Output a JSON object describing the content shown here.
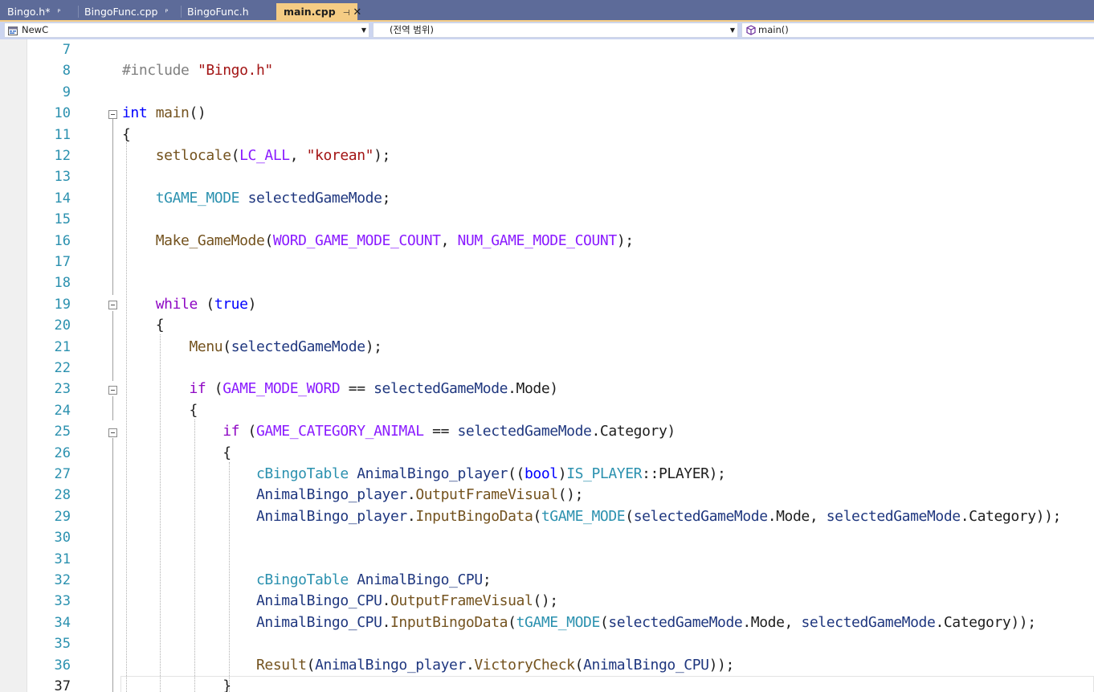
{
  "tabs": [
    {
      "label": "Bingo.h*",
      "pin": "ᴾ"
    },
    {
      "label": "BingoFunc.cpp",
      "pin": "ᴾ"
    },
    {
      "label": "BingoFunc.h"
    },
    {
      "label": "main.cpp",
      "pin": "⊣",
      "close": "✕"
    }
  ],
  "navigation": {
    "project": "NewC",
    "scope": "(전역 범위)",
    "member": "main()"
  },
  "editor": {
    "current_line": 37,
    "lines": [
      {
        "num": "7",
        "tokens": []
      },
      {
        "num": "8",
        "tokens": [
          [
            "preproc",
            "#include "
          ],
          [
            "str",
            "\"Bingo.h\""
          ]
        ]
      },
      {
        "num": "9",
        "tokens": []
      },
      {
        "num": "10",
        "tokens": [
          [
            "kw",
            "int"
          ],
          [
            "plain",
            " "
          ],
          [
            "func",
            "main"
          ],
          [
            "plain",
            "()"
          ]
        ]
      },
      {
        "num": "11",
        "tokens": [
          [
            "plain",
            "{"
          ]
        ]
      },
      {
        "num": "12",
        "tokens": [
          [
            "plain",
            "    "
          ],
          [
            "func",
            "setlocale"
          ],
          [
            "plain",
            "("
          ],
          [
            "macro",
            "LC_ALL"
          ],
          [
            "plain",
            ", "
          ],
          [
            "str",
            "\"korean\""
          ],
          [
            "plain",
            ");"
          ]
        ]
      },
      {
        "num": "13",
        "tokens": []
      },
      {
        "num": "14",
        "tokens": [
          [
            "plain",
            "    "
          ],
          [
            "type",
            "tGAME_MODE"
          ],
          [
            "plain",
            " "
          ],
          [
            "var",
            "selectedGameMode"
          ],
          [
            "plain",
            ";"
          ]
        ]
      },
      {
        "num": "15",
        "tokens": []
      },
      {
        "num": "16",
        "tokens": [
          [
            "plain",
            "    "
          ],
          [
            "func",
            "Make_GameMode"
          ],
          [
            "plain",
            "("
          ],
          [
            "macro",
            "WORD_GAME_MODE_COUNT"
          ],
          [
            "plain",
            ", "
          ],
          [
            "macro",
            "NUM_GAME_MODE_COUNT"
          ],
          [
            "plain",
            ");"
          ]
        ]
      },
      {
        "num": "17",
        "tokens": []
      },
      {
        "num": "18",
        "tokens": []
      },
      {
        "num": "19",
        "tokens": [
          [
            "plain",
            "    "
          ],
          [
            "ctrl",
            "while"
          ],
          [
            "plain",
            " ("
          ],
          [
            "kw",
            "true"
          ],
          [
            "plain",
            ")"
          ]
        ]
      },
      {
        "num": "20",
        "tokens": [
          [
            "plain",
            "    {"
          ]
        ]
      },
      {
        "num": "21",
        "tokens": [
          [
            "plain",
            "        "
          ],
          [
            "func",
            "Menu"
          ],
          [
            "plain",
            "("
          ],
          [
            "var",
            "selectedGameMode"
          ],
          [
            "plain",
            ");"
          ]
        ]
      },
      {
        "num": "22",
        "tokens": []
      },
      {
        "num": "23",
        "tokens": [
          [
            "plain",
            "        "
          ],
          [
            "ctrl",
            "if"
          ],
          [
            "plain",
            " ("
          ],
          [
            "macro",
            "GAME_MODE_WORD"
          ],
          [
            "plain",
            " == "
          ],
          [
            "var",
            "selectedGameMode"
          ],
          [
            "plain",
            ".Mode)"
          ]
        ]
      },
      {
        "num": "24",
        "tokens": [
          [
            "plain",
            "        {"
          ]
        ]
      },
      {
        "num": "25",
        "tokens": [
          [
            "plain",
            "            "
          ],
          [
            "ctrl",
            "if"
          ],
          [
            "plain",
            " ("
          ],
          [
            "macro",
            "GAME_CATEGORY_ANIMAL"
          ],
          [
            "plain",
            " == "
          ],
          [
            "var",
            "selectedGameMode"
          ],
          [
            "plain",
            ".Category)"
          ]
        ]
      },
      {
        "num": "26",
        "tokens": [
          [
            "plain",
            "            {"
          ]
        ]
      },
      {
        "num": "27",
        "tokens": [
          [
            "plain",
            "                "
          ],
          [
            "type",
            "cBingoTable"
          ],
          [
            "plain",
            " "
          ],
          [
            "var",
            "AnimalBingo_player"
          ],
          [
            "plain",
            "(("
          ],
          [
            "kw",
            "bool"
          ],
          [
            "plain",
            ")"
          ],
          [
            "type",
            "IS_PLAYER"
          ],
          [
            "plain",
            "::PLAYER);"
          ]
        ]
      },
      {
        "num": "28",
        "tokens": [
          [
            "plain",
            "                "
          ],
          [
            "var",
            "AnimalBingo_player"
          ],
          [
            "plain",
            "."
          ],
          [
            "func",
            "OutputFrameVisual"
          ],
          [
            "plain",
            "();"
          ]
        ]
      },
      {
        "num": "29",
        "tokens": [
          [
            "plain",
            "                "
          ],
          [
            "var",
            "AnimalBingo_player"
          ],
          [
            "plain",
            "."
          ],
          [
            "func",
            "InputBingoData"
          ],
          [
            "plain",
            "("
          ],
          [
            "type",
            "tGAME_MODE"
          ],
          [
            "plain",
            "("
          ],
          [
            "var",
            "selectedGameMode"
          ],
          [
            "plain",
            ".Mode, "
          ],
          [
            "var",
            "selectedGameMode"
          ],
          [
            "plain",
            ".Category));"
          ]
        ]
      },
      {
        "num": "30",
        "tokens": []
      },
      {
        "num": "31",
        "tokens": []
      },
      {
        "num": "32",
        "tokens": [
          [
            "plain",
            "                "
          ],
          [
            "type",
            "cBingoTable"
          ],
          [
            "plain",
            " "
          ],
          [
            "var",
            "AnimalBingo_CPU"
          ],
          [
            "plain",
            ";"
          ]
        ]
      },
      {
        "num": "33",
        "tokens": [
          [
            "plain",
            "                "
          ],
          [
            "var",
            "AnimalBingo_CPU"
          ],
          [
            "plain",
            "."
          ],
          [
            "func",
            "OutputFrameVisual"
          ],
          [
            "plain",
            "();"
          ]
        ]
      },
      {
        "num": "34",
        "tokens": [
          [
            "plain",
            "                "
          ],
          [
            "var",
            "AnimalBingo_CPU"
          ],
          [
            "plain",
            "."
          ],
          [
            "func",
            "InputBingoData"
          ],
          [
            "plain",
            "("
          ],
          [
            "type",
            "tGAME_MODE"
          ],
          [
            "plain",
            "("
          ],
          [
            "var",
            "selectedGameMode"
          ],
          [
            "plain",
            ".Mode, "
          ],
          [
            "var",
            "selectedGameMode"
          ],
          [
            "plain",
            ".Category));"
          ]
        ]
      },
      {
        "num": "35",
        "tokens": []
      },
      {
        "num": "36",
        "tokens": [
          [
            "plain",
            "                "
          ],
          [
            "func",
            "Result"
          ],
          [
            "plain",
            "("
          ],
          [
            "var",
            "AnimalBingo_player"
          ],
          [
            "plain",
            "."
          ],
          [
            "func",
            "VictoryCheck"
          ],
          [
            "plain",
            "("
          ],
          [
            "var",
            "AnimalBingo_CPU"
          ],
          [
            "plain",
            "));"
          ]
        ]
      },
      {
        "num": "37",
        "tokens": [
          [
            "plain",
            "            }"
          ]
        ]
      }
    ]
  },
  "colors": {
    "kw": "#0000ff",
    "ctrl": "#8f08c4",
    "preproc": "#808080",
    "str": "#a31515",
    "func": "#74531f",
    "macro": "#8a1bff",
    "type": "#2b91af",
    "var": "#1f377f",
    "plain": "#1e1e1e",
    "tabbar_bg": "#5d6b99",
    "active_tab_bg": "#f5cc84",
    "line_number": "#2b91af"
  },
  "icons": {
    "project": "project-icon",
    "member": "function-cube-icon",
    "dropdown": "chevron-down-icon"
  }
}
